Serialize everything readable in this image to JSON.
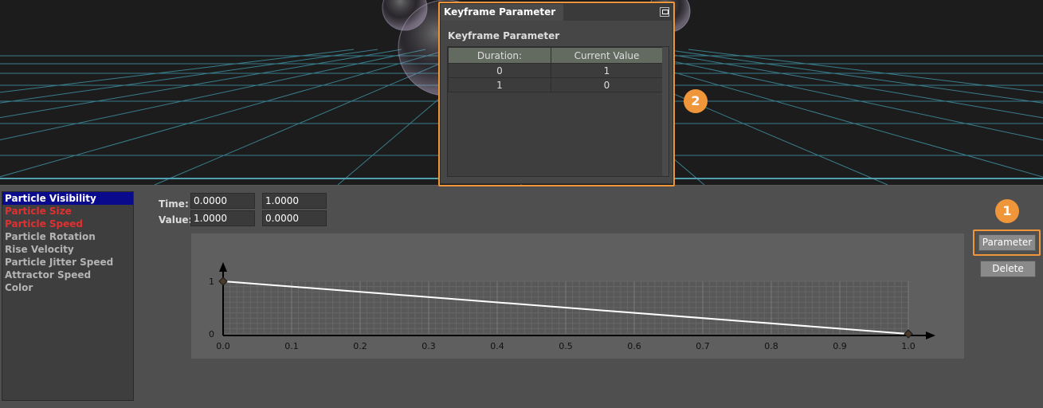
{
  "curves": [
    {
      "label": "Particle Visibility",
      "state": "selected"
    },
    {
      "label": "Particle Size",
      "state": "red"
    },
    {
      "label": "Particle Speed",
      "state": "red"
    },
    {
      "label": "Particle Rotation",
      "state": "normal"
    },
    {
      "label": "Rise Velocity",
      "state": "normal"
    },
    {
      "label": "Particle Jitter Speed",
      "state": "normal"
    },
    {
      "label": "Attractor Speed",
      "state": "normal"
    },
    {
      "label": "Color",
      "state": "normal"
    }
  ],
  "editor": {
    "time_label": "Time:",
    "value_label": "Value:",
    "time_values": [
      "0.0000",
      "1.0000"
    ],
    "value_values": [
      "1.0000",
      "0.0000"
    ]
  },
  "buttons": {
    "parameter": "Parameter",
    "delete": "Delete"
  },
  "badges": {
    "one": "1",
    "two": "2"
  },
  "dialog": {
    "tab_title": "Keyframe Parameter",
    "heading": "Keyframe Parameter",
    "columns": [
      "Duration:",
      "Current Value"
    ],
    "rows": [
      [
        "0",
        "1"
      ],
      [
        "1",
        "0"
      ]
    ]
  },
  "chart_data": {
    "type": "line",
    "x_ticks": [
      "0.0",
      "0.1",
      "0.2",
      "0.3",
      "0.4",
      "0.5",
      "0.6",
      "0.7",
      "0.8",
      "0.9",
      "1.0"
    ],
    "y_ticks": [
      "0",
      "1"
    ],
    "xlim": [
      0,
      1
    ],
    "ylim": [
      0,
      1
    ],
    "grid": true,
    "points": [
      {
        "x": 0,
        "y": 1
      },
      {
        "x": 1,
        "y": 0
      }
    ],
    "line_color": "#ffffff",
    "keyframe_color": "#4a3a2a"
  },
  "colors": {
    "highlight": "#f0963a",
    "selection": "#0a0a8c",
    "error_text": "#e03030"
  }
}
